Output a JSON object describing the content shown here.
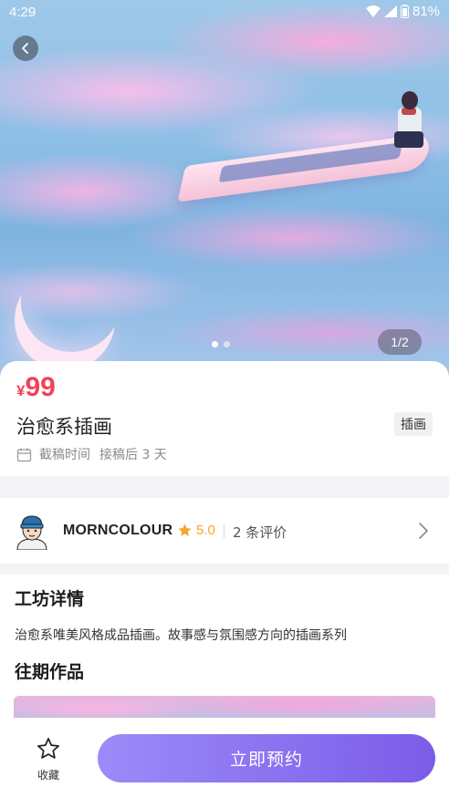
{
  "status_bar": {
    "time": "4:29",
    "battery": "81%"
  },
  "hero": {
    "page_indicator": "1/2",
    "dots_count": 2,
    "active_dot": 1
  },
  "product": {
    "currency": "¥",
    "price": "99",
    "title": "治愈系插画",
    "tag": "插画",
    "deadline_label": "截稿时间",
    "deadline_value": "接稿后 3 天"
  },
  "artist": {
    "name": "MORNCOLOUR",
    "rating": "5.0",
    "reviews": "2 条评价"
  },
  "details": {
    "section_title": "工坊详情",
    "description": "治愈系唯美风格成品插画。故事感与氛围感方向的插画系列",
    "past_works_title": "往期作品"
  },
  "bottom_bar": {
    "favorite_label": "收藏",
    "book_label": "立即预约"
  },
  "colors": {
    "price": "#f0435a",
    "star": "#f5a623",
    "button_start": "#9c8bf9",
    "button_end": "#7b5ce8"
  },
  "icons": [
    "back-icon",
    "wifi-icon",
    "signal-icon",
    "battery-icon",
    "calendar-icon",
    "star-icon",
    "chevron-right-icon",
    "favorite-star-outline-icon"
  ]
}
